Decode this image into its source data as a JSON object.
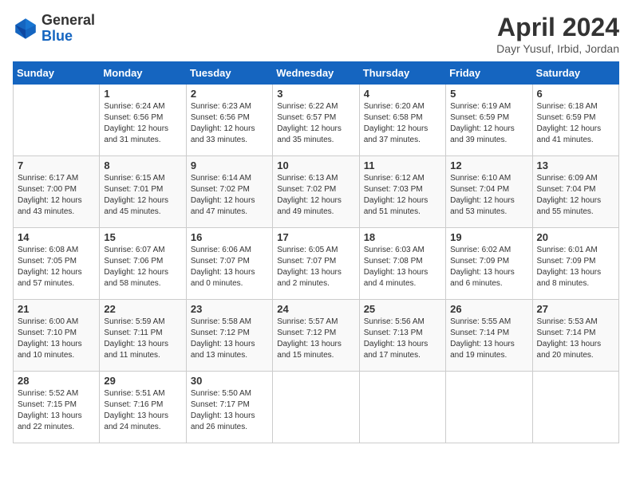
{
  "header": {
    "logo_general": "General",
    "logo_blue": "Blue",
    "month_title": "April 2024",
    "subtitle": "Dayr Yusuf, Irbid, Jordan"
  },
  "weekdays": [
    "Sunday",
    "Monday",
    "Tuesday",
    "Wednesday",
    "Thursday",
    "Friday",
    "Saturday"
  ],
  "weeks": [
    [
      {
        "day": "",
        "sunrise": "",
        "sunset": "",
        "daylight": ""
      },
      {
        "day": "1",
        "sunrise": "Sunrise: 6:24 AM",
        "sunset": "Sunset: 6:56 PM",
        "daylight": "Daylight: 12 hours and 31 minutes."
      },
      {
        "day": "2",
        "sunrise": "Sunrise: 6:23 AM",
        "sunset": "Sunset: 6:56 PM",
        "daylight": "Daylight: 12 hours and 33 minutes."
      },
      {
        "day": "3",
        "sunrise": "Sunrise: 6:22 AM",
        "sunset": "Sunset: 6:57 PM",
        "daylight": "Daylight: 12 hours and 35 minutes."
      },
      {
        "day": "4",
        "sunrise": "Sunrise: 6:20 AM",
        "sunset": "Sunset: 6:58 PM",
        "daylight": "Daylight: 12 hours and 37 minutes."
      },
      {
        "day": "5",
        "sunrise": "Sunrise: 6:19 AM",
        "sunset": "Sunset: 6:59 PM",
        "daylight": "Daylight: 12 hours and 39 minutes."
      },
      {
        "day": "6",
        "sunrise": "Sunrise: 6:18 AM",
        "sunset": "Sunset: 6:59 PM",
        "daylight": "Daylight: 12 hours and 41 minutes."
      }
    ],
    [
      {
        "day": "7",
        "sunrise": "Sunrise: 6:17 AM",
        "sunset": "Sunset: 7:00 PM",
        "daylight": "Daylight: 12 hours and 43 minutes."
      },
      {
        "day": "8",
        "sunrise": "Sunrise: 6:15 AM",
        "sunset": "Sunset: 7:01 PM",
        "daylight": "Daylight: 12 hours and 45 minutes."
      },
      {
        "day": "9",
        "sunrise": "Sunrise: 6:14 AM",
        "sunset": "Sunset: 7:02 PM",
        "daylight": "Daylight: 12 hours and 47 minutes."
      },
      {
        "day": "10",
        "sunrise": "Sunrise: 6:13 AM",
        "sunset": "Sunset: 7:02 PM",
        "daylight": "Daylight: 12 hours and 49 minutes."
      },
      {
        "day": "11",
        "sunrise": "Sunrise: 6:12 AM",
        "sunset": "Sunset: 7:03 PM",
        "daylight": "Daylight: 12 hours and 51 minutes."
      },
      {
        "day": "12",
        "sunrise": "Sunrise: 6:10 AM",
        "sunset": "Sunset: 7:04 PM",
        "daylight": "Daylight: 12 hours and 53 minutes."
      },
      {
        "day": "13",
        "sunrise": "Sunrise: 6:09 AM",
        "sunset": "Sunset: 7:04 PM",
        "daylight": "Daylight: 12 hours and 55 minutes."
      }
    ],
    [
      {
        "day": "14",
        "sunrise": "Sunrise: 6:08 AM",
        "sunset": "Sunset: 7:05 PM",
        "daylight": "Daylight: 12 hours and 57 minutes."
      },
      {
        "day": "15",
        "sunrise": "Sunrise: 6:07 AM",
        "sunset": "Sunset: 7:06 PM",
        "daylight": "Daylight: 12 hours and 58 minutes."
      },
      {
        "day": "16",
        "sunrise": "Sunrise: 6:06 AM",
        "sunset": "Sunset: 7:07 PM",
        "daylight": "Daylight: 13 hours and 0 minutes."
      },
      {
        "day": "17",
        "sunrise": "Sunrise: 6:05 AM",
        "sunset": "Sunset: 7:07 PM",
        "daylight": "Daylight: 13 hours and 2 minutes."
      },
      {
        "day": "18",
        "sunrise": "Sunrise: 6:03 AM",
        "sunset": "Sunset: 7:08 PM",
        "daylight": "Daylight: 13 hours and 4 minutes."
      },
      {
        "day": "19",
        "sunrise": "Sunrise: 6:02 AM",
        "sunset": "Sunset: 7:09 PM",
        "daylight": "Daylight: 13 hours and 6 minutes."
      },
      {
        "day": "20",
        "sunrise": "Sunrise: 6:01 AM",
        "sunset": "Sunset: 7:09 PM",
        "daylight": "Daylight: 13 hours and 8 minutes."
      }
    ],
    [
      {
        "day": "21",
        "sunrise": "Sunrise: 6:00 AM",
        "sunset": "Sunset: 7:10 PM",
        "daylight": "Daylight: 13 hours and 10 minutes."
      },
      {
        "day": "22",
        "sunrise": "Sunrise: 5:59 AM",
        "sunset": "Sunset: 7:11 PM",
        "daylight": "Daylight: 13 hours and 11 minutes."
      },
      {
        "day": "23",
        "sunrise": "Sunrise: 5:58 AM",
        "sunset": "Sunset: 7:12 PM",
        "daylight": "Daylight: 13 hours and 13 minutes."
      },
      {
        "day": "24",
        "sunrise": "Sunrise: 5:57 AM",
        "sunset": "Sunset: 7:12 PM",
        "daylight": "Daylight: 13 hours and 15 minutes."
      },
      {
        "day": "25",
        "sunrise": "Sunrise: 5:56 AM",
        "sunset": "Sunset: 7:13 PM",
        "daylight": "Daylight: 13 hours and 17 minutes."
      },
      {
        "day": "26",
        "sunrise": "Sunrise: 5:55 AM",
        "sunset": "Sunset: 7:14 PM",
        "daylight": "Daylight: 13 hours and 19 minutes."
      },
      {
        "day": "27",
        "sunrise": "Sunrise: 5:53 AM",
        "sunset": "Sunset: 7:14 PM",
        "daylight": "Daylight: 13 hours and 20 minutes."
      }
    ],
    [
      {
        "day": "28",
        "sunrise": "Sunrise: 5:52 AM",
        "sunset": "Sunset: 7:15 PM",
        "daylight": "Daylight: 13 hours and 22 minutes."
      },
      {
        "day": "29",
        "sunrise": "Sunrise: 5:51 AM",
        "sunset": "Sunset: 7:16 PM",
        "daylight": "Daylight: 13 hours and 24 minutes."
      },
      {
        "day": "30",
        "sunrise": "Sunrise: 5:50 AM",
        "sunset": "Sunset: 7:17 PM",
        "daylight": "Daylight: 13 hours and 26 minutes."
      },
      {
        "day": "",
        "sunrise": "",
        "sunset": "",
        "daylight": ""
      },
      {
        "day": "",
        "sunrise": "",
        "sunset": "",
        "daylight": ""
      },
      {
        "day": "",
        "sunrise": "",
        "sunset": "",
        "daylight": ""
      },
      {
        "day": "",
        "sunrise": "",
        "sunset": "",
        "daylight": ""
      }
    ]
  ]
}
